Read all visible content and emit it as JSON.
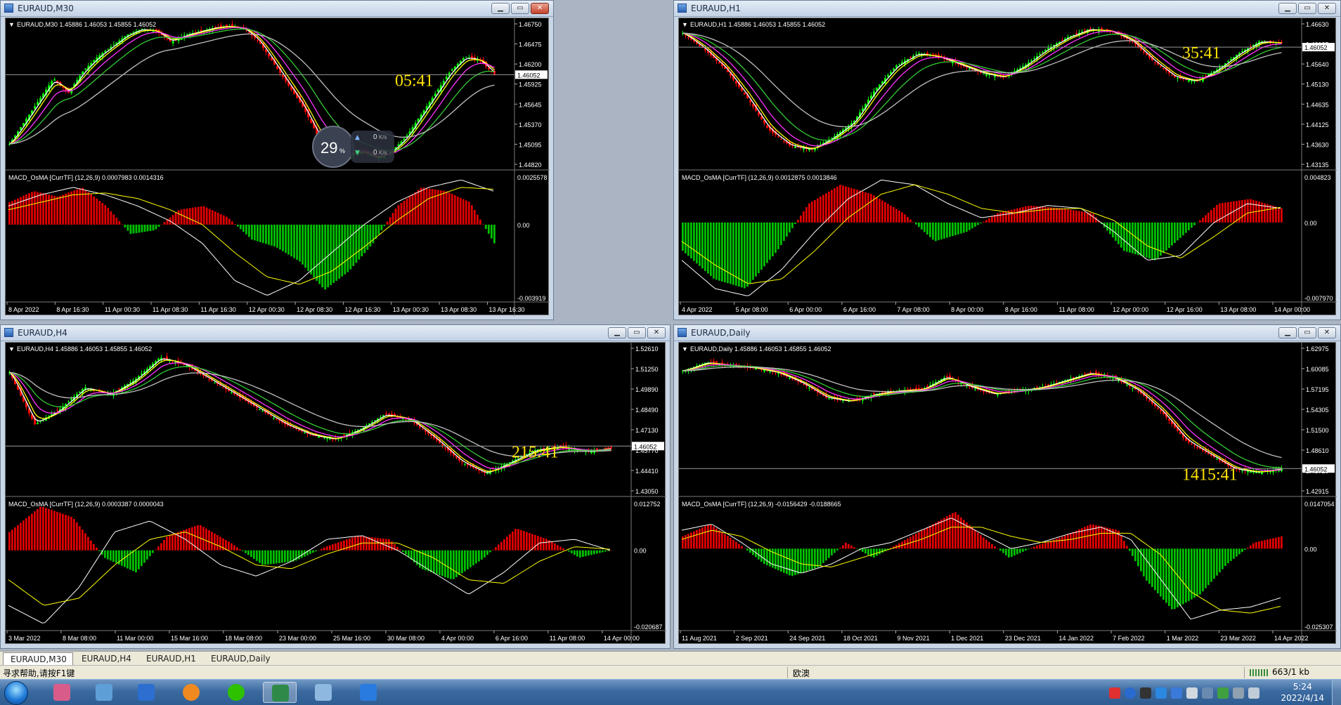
{
  "windows": [
    {
      "title": "EURAUD,M30",
      "info": "EURAUD,M30  1.45886 1.46053 1.45855 1.46052",
      "timer": "05:41",
      "price_ticks": [
        "1.46750",
        "1.46475",
        "1.46200",
        "1.45925",
        "1.45645",
        "1.45370",
        "1.45095",
        "1.44820"
      ],
      "current_price": "1.46052",
      "macd_label": "MACD_OsMA [CurrTF] (12,26,9) 0.0007983 0.0014316",
      "macd_ticks": [
        "0.0025578",
        "0.00",
        "-0.003919"
      ],
      "time_ticks": [
        "8 Apr 2022",
        "8 Apr 16:30",
        "11 Apr 00:30",
        "11 Apr 08:30",
        "11 Apr 16:30",
        "12 Apr 00:30",
        "12 Apr 08:30",
        "12 Apr 16:30",
        "13 Apr 00:30",
        "13 Apr 08:30",
        "13 Apr 16:30"
      ]
    },
    {
      "title": "EURAUD,H1",
      "info": "EURAUD,H1  1.45886 1.46053 1.45855 1.46052",
      "timer": "35:41",
      "price_ticks": [
        "1.46630",
        "1.46135",
        "1.45640",
        "1.45130",
        "1.44635",
        "1.44125",
        "1.43630",
        "1.43135"
      ],
      "current_price": "1.46052",
      "macd_label": "MACD_OsMA [CurrTF] (12,26,9) 0.0012875 0.0013846",
      "macd_ticks": [
        "0.004823",
        "0.00",
        "-0.007970"
      ],
      "time_ticks": [
        "4 Apr 2022",
        "5 Apr 08:00",
        "6 Apr 00:00",
        "6 Apr 16:00",
        "7 Apr 08:00",
        "8 Apr 00:00",
        "8 Apr 16:00",
        "11 Apr 08:00",
        "12 Apr 00:00",
        "12 Apr 16:00",
        "13 Apr 08:00",
        "14 Apr 00:00"
      ]
    },
    {
      "title": "EURAUD,H4",
      "info": "EURAUD,H4  1.45886 1.46053 1.45855 1.46052",
      "timer": "215:41",
      "price_ticks": [
        "1.52610",
        "1.51250",
        "1.49890",
        "1.48490",
        "1.47130",
        "1.45770",
        "1.44410",
        "1.43050"
      ],
      "current_price": "1.46052",
      "macd_label": "MACD_OsMA [CurrTF] (12,26,9) 0.0003387 0.0000043",
      "macd_ticks": [
        "0.012752",
        "0.00",
        "-0.020687"
      ],
      "time_ticks": [
        "3 Mar 2022",
        "8 Mar 08:00",
        "11 Mar 00:00",
        "15 Mar 16:00",
        "18 Mar 08:00",
        "23 Mar 00:00",
        "25 Mar 16:00",
        "30 Mar 08:00",
        "4 Apr 00:00",
        "6 Apr 16:00",
        "11 Apr 08:00",
        "14 Apr 00:00"
      ]
    },
    {
      "title": "EURAUD,Daily",
      "info": "EURAUD,Daily  1.45886 1.46053 1.45855 1.46052",
      "timer": "1415:41",
      "price_ticks": [
        "1.62975",
        "1.60085",
        "1.57195",
        "1.54305",
        "1.51500",
        "1.48610",
        "1.45720",
        "1.42915"
      ],
      "current_price": "1.46052",
      "macd_label": "MACD_OsMA [CurrTF] (12,26,9) -0.0156429 -0.0188665",
      "macd_ticks": [
        "0.0147054",
        "0.00",
        "-0.025307"
      ],
      "time_ticks": [
        "11 Aug 2021",
        "2 Sep 2021",
        "24 Sep 2021",
        "18 Oct 2021",
        "9 Nov 2021",
        "1 Dec 2021",
        "23 Dec 2021",
        "14 Jan 2022",
        "7 Feb 2022",
        "1 Mar 2022",
        "23 Mar 2022",
        "14 Apr 2022"
      ]
    }
  ],
  "speed_widget": {
    "percent": "29",
    "unit": "%",
    "up": "0",
    "down": "0",
    "rate_unit": "K/s"
  },
  "tabs": [
    "EURAUD,M30",
    "EURAUD,H4",
    "EURAUD,H1",
    "EURAUD,Daily"
  ],
  "status": {
    "help": "寻求帮助,请按F1键",
    "profile": "欧澳",
    "traffic": "663/1 kb"
  },
  "clock": {
    "time": "5:24",
    "date": "2022/4/14"
  },
  "colors": {
    "bull": "#00ff00",
    "bear": "#ff0000",
    "ma_white": "#ffffff",
    "ma_yellow": "#ffff00",
    "ma_magenta": "#ff33ff",
    "ma_green": "#33cc33",
    "ma_gray": "#c0c0c0",
    "timer": "#ffe100",
    "hist_pos": "#e00000",
    "hist_neg": "#00c000"
  },
  "chart_data": [
    {
      "type": "candlestick",
      "title": "EURAUD,M30",
      "ylim": [
        1.4482,
        1.4675
      ],
      "close_series": [
        1.451,
        1.454,
        1.457,
        1.46,
        1.458,
        1.461,
        1.463,
        1.4645,
        1.466,
        1.4668,
        1.4665,
        1.465,
        1.466,
        1.4665,
        1.467,
        1.4672,
        1.4668,
        1.465,
        1.462,
        1.459,
        1.456,
        1.452,
        1.45,
        1.4495,
        1.45,
        1.449,
        1.45,
        1.452,
        1.455,
        1.458,
        1.461,
        1.463,
        1.4625,
        1.4605
      ],
      "macd_hist_series": [
        0.0012,
        0.0018,
        0.0015,
        0.002,
        0.001,
        -0.0005,
        -0.0003,
        0.0008,
        0.001,
        0.0004,
        -0.0008,
        -0.0012,
        -0.002,
        -0.0035,
        -0.0025,
        -0.001,
        0.001,
        0.002,
        0.0018,
        0.0012,
        -0.001
      ],
      "macd_line_series": [
        0.001,
        0.0016,
        0.002,
        0.0016,
        0.001,
        0.0002,
        -0.001,
        -0.003,
        -0.0038,
        -0.003,
        -0.0015,
        0.0,
        0.0012,
        0.002,
        0.0024,
        0.0018
      ],
      "signal_line_series": [
        0.0008,
        0.0012,
        0.0016,
        0.0017,
        0.0014,
        0.0008,
        0.0,
        -0.0015,
        -0.0028,
        -0.0032,
        -0.0025,
        -0.0012,
        0.0002,
        0.0014,
        0.002,
        0.0019
      ]
    },
    {
      "type": "candlestick",
      "title": "EURAUD,H1",
      "ylim": [
        1.43135,
        1.4663
      ],
      "close_series": [
        1.464,
        1.46,
        1.455,
        1.448,
        1.44,
        1.436,
        1.435,
        1.438,
        1.442,
        1.45,
        1.456,
        1.459,
        1.458,
        1.456,
        1.454,
        1.453,
        1.456,
        1.46,
        1.463,
        1.465,
        1.4645,
        1.462,
        1.457,
        1.453,
        1.452,
        1.455,
        1.459,
        1.462,
        1.4615
      ],
      "macd_hist_series": [
        -0.003,
        -0.006,
        -0.007,
        -0.003,
        0.002,
        0.004,
        0.003,
        0.001,
        -0.002,
        -0.001,
        0.001,
        0.0018,
        0.0015,
        0.001,
        -0.003,
        -0.004,
        -0.001,
        0.002,
        0.0025,
        0.0015
      ],
      "macd_line_series": [
        -0.004,
        -0.007,
        -0.0078,
        -0.005,
        -0.001,
        0.0025,
        0.0045,
        0.004,
        0.002,
        0.0005,
        0.001,
        0.0018,
        0.0015,
        -0.001,
        -0.004,
        -0.0035,
        0.0,
        0.002,
        0.0015
      ],
      "signal_line_series": [
        -0.002,
        -0.0045,
        -0.0065,
        -0.006,
        -0.003,
        0.0005,
        0.003,
        0.004,
        0.003,
        0.0015,
        0.001,
        0.0014,
        0.0015,
        0.0002,
        -0.0025,
        -0.0038,
        -0.0015,
        0.001,
        0.0016
      ]
    },
    {
      "type": "candlestick",
      "title": "EURAUD,H4",
      "ylim": [
        1.4305,
        1.5261
      ],
      "close_series": [
        1.51,
        1.475,
        1.485,
        1.5,
        1.495,
        1.505,
        1.52,
        1.515,
        1.505,
        1.495,
        1.485,
        1.475,
        1.468,
        1.465,
        1.472,
        1.482,
        1.478,
        1.465,
        1.45,
        1.442,
        1.45,
        1.458,
        1.46,
        1.457,
        1.459
      ],
      "macd_hist_series": [
        0.005,
        0.012,
        0.009,
        -0.002,
        -0.006,
        0.004,
        0.007,
        0.002,
        -0.004,
        -0.003,
        0.001,
        0.004,
        0.003,
        -0.005,
        -0.008,
        -0.002,
        0.006,
        0.003,
        -0.002,
        0.0
      ],
      "macd_line_series": [
        -0.015,
        -0.02,
        -0.01,
        0.005,
        0.008,
        0.003,
        -0.004,
        -0.007,
        -0.003,
        0.003,
        0.004,
        0.0,
        -0.006,
        -0.012,
        -0.006,
        0.002,
        0.003,
        0.0
      ],
      "signal_line_series": [
        -0.008,
        -0.015,
        -0.013,
        -0.004,
        0.003,
        0.005,
        0.001,
        -0.004,
        -0.005,
        -0.001,
        0.002,
        0.002,
        -0.002,
        -0.008,
        -0.009,
        -0.003,
        0.001,
        0.0003
      ]
    },
    {
      "type": "candlestick",
      "title": "EURAUD,Daily",
      "ylim": [
        1.42915,
        1.62975
      ],
      "close_series": [
        1.598,
        1.61,
        1.605,
        1.602,
        1.595,
        1.58,
        1.56,
        1.555,
        1.565,
        1.57,
        1.572,
        1.59,
        1.575,
        1.565,
        1.57,
        1.575,
        1.585,
        1.595,
        1.588,
        1.57,
        1.54,
        1.5,
        1.48,
        1.46,
        1.455,
        1.4605
      ],
      "macd_hist_series": [
        0.004,
        0.008,
        0.002,
        -0.005,
        -0.009,
        -0.006,
        0.002,
        -0.003,
        0.002,
        0.007,
        0.012,
        0.004,
        -0.003,
        0.001,
        0.004,
        0.008,
        0.006,
        -0.01,
        -0.02,
        -0.015,
        -0.005,
        0.002,
        0.004
      ],
      "macd_line_series": [
        0.006,
        0.008,
        0.002,
        -0.005,
        -0.008,
        -0.005,
        0.0,
        0.002,
        0.006,
        0.01,
        0.005,
        0.0,
        0.002,
        0.005,
        0.007,
        0.003,
        -0.01,
        -0.023,
        -0.02,
        -0.019,
        -0.016
      ],
      "signal_line_series": [
        0.003,
        0.006,
        0.004,
        -0.001,
        -0.005,
        -0.006,
        -0.003,
        0.0,
        0.003,
        0.007,
        0.007,
        0.004,
        0.002,
        0.003,
        0.005,
        0.005,
        -0.002,
        -0.014,
        -0.02,
        -0.021,
        -0.0188
      ]
    }
  ]
}
